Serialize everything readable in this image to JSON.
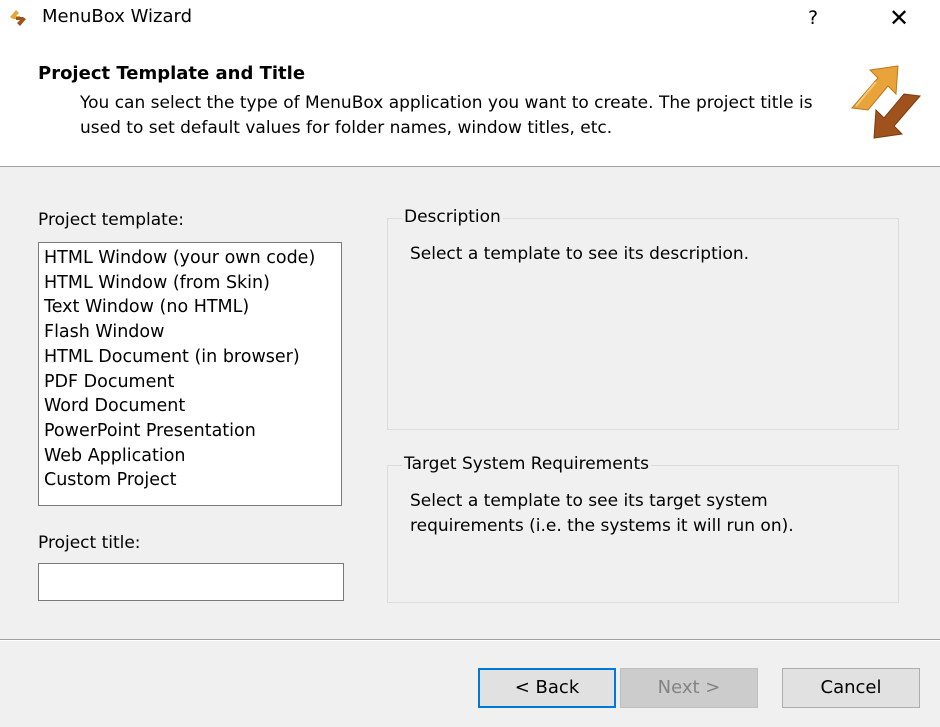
{
  "window": {
    "title": "MenuBox Wizard",
    "help_label": "?",
    "close_label": "✕"
  },
  "header": {
    "title": "Project Template and Title",
    "description": "You can select the type of MenuBox application you want to create. The project title is used to set default values for folder names, window titles, etc."
  },
  "template": {
    "label": "Project template:",
    "items": [
      "HTML Window (your own code)",
      "HTML Window (from Skin)",
      "Text Window (no HTML)",
      "Flash Window",
      "HTML Document (in browser)",
      "PDF Document",
      "Word Document",
      "PowerPoint Presentation",
      "Web Application",
      "Custom Project"
    ]
  },
  "project_title": {
    "label": "Project title:",
    "value": ""
  },
  "description_group": {
    "legend": "Description",
    "text": "Select a template to see its description."
  },
  "requirements_group": {
    "legend": "Target System Requirements",
    "text": "Select a template to see its target system requirements (i.e. the systems it will run on)."
  },
  "buttons": {
    "back": "< Back",
    "next": "Next >",
    "cancel": "Cancel"
  },
  "colors": {
    "accent": "#0078d7",
    "logo_orange": "#e8a33a",
    "logo_brown": "#a0521d"
  },
  "icons": {
    "app": "menubox-app-icon",
    "logo": "menubox-wizard-logo"
  }
}
